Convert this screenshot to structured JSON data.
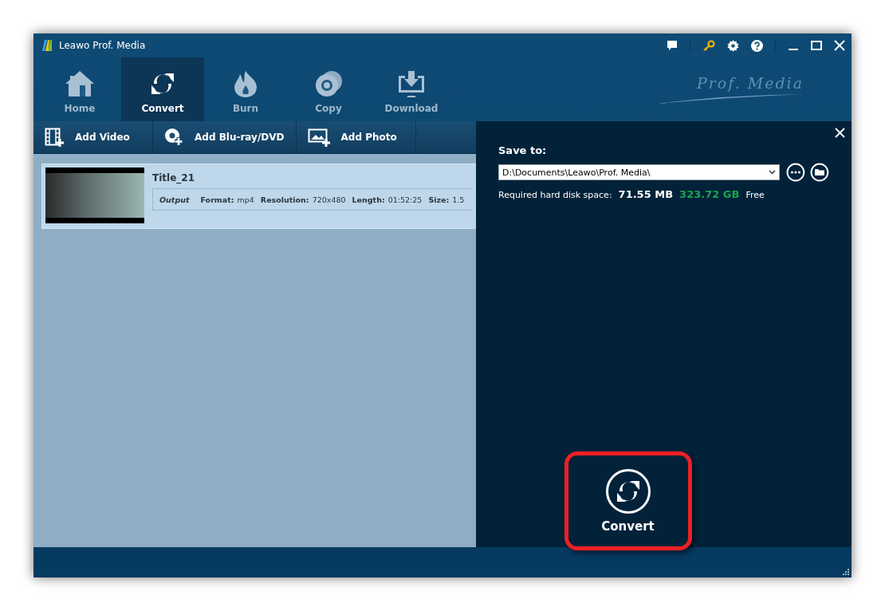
{
  "window": {
    "title": "Leawo Prof. Media"
  },
  "brand_logo": "Prof. Media",
  "nav_tabs": [
    {
      "label": "Home",
      "kind": "home",
      "selected": false
    },
    {
      "label": "Convert",
      "kind": "convert",
      "selected": true
    },
    {
      "label": "Burn",
      "kind": "burn",
      "selected": false
    },
    {
      "label": "Copy",
      "kind": "copy",
      "selected": false
    },
    {
      "label": "Download",
      "kind": "download",
      "selected": false
    }
  ],
  "toolbar": [
    {
      "label": "Add Video",
      "kind": "video"
    },
    {
      "label": "Add Blu-ray/DVD",
      "kind": "disc"
    },
    {
      "label": "Add Photo",
      "kind": "photo"
    }
  ],
  "files": [
    {
      "title": "Title_21",
      "selected": true,
      "output_label": "Output",
      "fields": [
        {
          "label": "Format:",
          "value": "mp4"
        },
        {
          "label": "Resolution:",
          "value": "720x480"
        },
        {
          "label": "Length:",
          "value": "01:52:25"
        },
        {
          "label": "Size:",
          "value": "1.5"
        }
      ]
    }
  ],
  "save_panel": {
    "label": "Save to:",
    "path": "D:\\Documents\\Leawo\\Prof. Media\\",
    "required_label": "Required hard disk space:",
    "required_size": "71.55 MB",
    "free_size": "323.72 GB",
    "free_label": "Free"
  },
  "convert_button": {
    "label": "Convert",
    "highlighted": true
  }
}
